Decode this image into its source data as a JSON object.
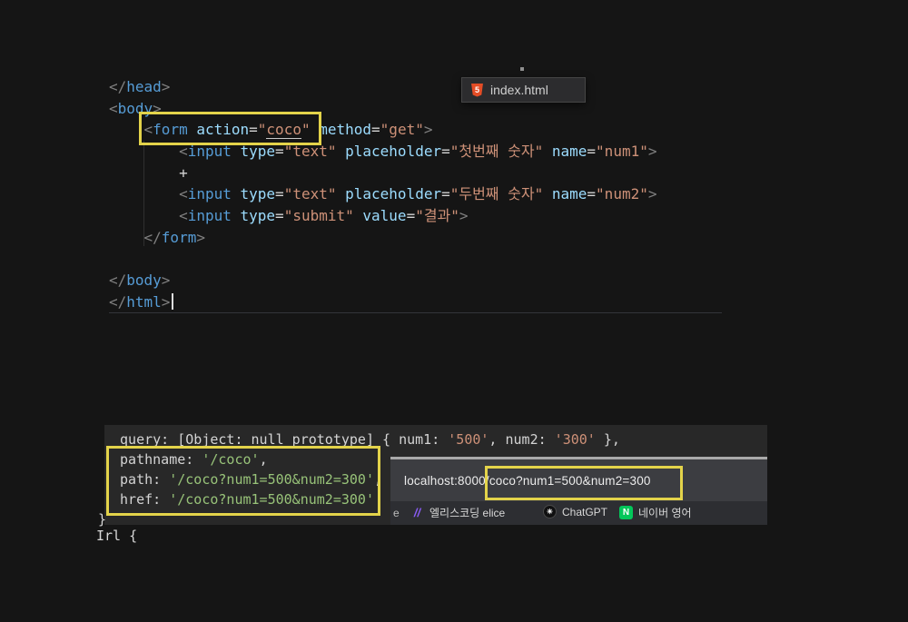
{
  "editor": {
    "lines": [
      {
        "tokens": [
          [
            "</",
            "punct"
          ],
          [
            "head",
            "tag"
          ],
          [
            ">",
            "punct"
          ]
        ]
      },
      {
        "tokens": [
          [
            "<",
            "punct"
          ],
          [
            "body",
            "tag"
          ],
          [
            ">",
            "punct"
          ]
        ]
      },
      {
        "tokens": [
          [
            "    ",
            "plain"
          ],
          [
            "<",
            "punct"
          ],
          [
            "form",
            "tag"
          ],
          [
            " ",
            "plain"
          ],
          [
            "action",
            "attr"
          ],
          [
            "=",
            "plain"
          ],
          [
            "\"",
            "str"
          ],
          [
            "coco",
            "str-u"
          ],
          [
            "\"",
            "str"
          ],
          [
            " ",
            "plain"
          ],
          [
            "method",
            "attr"
          ],
          [
            "=",
            "plain"
          ],
          [
            "\"get\"",
            "str"
          ],
          [
            ">",
            "punct"
          ]
        ]
      },
      {
        "tokens": [
          [
            "        ",
            "plain"
          ],
          [
            "<",
            "punct"
          ],
          [
            "input",
            "tag"
          ],
          [
            " ",
            "plain"
          ],
          [
            "type",
            "attr"
          ],
          [
            "=",
            "plain"
          ],
          [
            "\"text\"",
            "str"
          ],
          [
            " ",
            "plain"
          ],
          [
            "placeholder",
            "attr"
          ],
          [
            "=",
            "plain"
          ],
          [
            "\"첫번째 숫자\"",
            "str"
          ],
          [
            " ",
            "plain"
          ],
          [
            "name",
            "attr"
          ],
          [
            "=",
            "plain"
          ],
          [
            "\"num1\"",
            "str"
          ],
          [
            ">",
            "punct"
          ]
        ]
      },
      {
        "tokens": [
          [
            "        +",
            "plain"
          ]
        ]
      },
      {
        "tokens": [
          [
            "        ",
            "plain"
          ],
          [
            "<",
            "punct"
          ],
          [
            "input",
            "tag"
          ],
          [
            " ",
            "plain"
          ],
          [
            "type",
            "attr"
          ],
          [
            "=",
            "plain"
          ],
          [
            "\"text\"",
            "str"
          ],
          [
            " ",
            "plain"
          ],
          [
            "placeholder",
            "attr"
          ],
          [
            "=",
            "plain"
          ],
          [
            "\"두번째 숫자\"",
            "str"
          ],
          [
            " ",
            "plain"
          ],
          [
            "name",
            "attr"
          ],
          [
            "=",
            "plain"
          ],
          [
            "\"num2\"",
            "str"
          ],
          [
            ">",
            "punct"
          ]
        ]
      },
      {
        "tokens": [
          [
            "        ",
            "plain"
          ],
          [
            "<",
            "punct"
          ],
          [
            "input",
            "tag"
          ],
          [
            " ",
            "plain"
          ],
          [
            "type",
            "attr"
          ],
          [
            "=",
            "plain"
          ],
          [
            "\"submit\"",
            "str"
          ],
          [
            " ",
            "plain"
          ],
          [
            "value",
            "attr"
          ],
          [
            "=",
            "plain"
          ],
          [
            "\"결과\"",
            "str"
          ],
          [
            ">",
            "punct"
          ]
        ]
      },
      {
        "tokens": [
          [
            "    ",
            "plain"
          ],
          [
            "</",
            "punct"
          ],
          [
            "form",
            "tag"
          ],
          [
            ">",
            "punct"
          ]
        ]
      },
      {
        "tokens": []
      },
      {
        "tokens": [
          [
            "</",
            "punct"
          ],
          [
            "body",
            "tag"
          ],
          [
            ">",
            "punct"
          ]
        ]
      },
      {
        "tokens": [
          [
            "</",
            "punct"
          ],
          [
            "html",
            "tag"
          ],
          [
            ">",
            "punct"
          ]
        ],
        "cursor": true
      }
    ]
  },
  "tooltip": {
    "label": "index.html",
    "icon_glyph": "5"
  },
  "terminal": {
    "lines": [
      {
        "tokens": [
          [
            " query: [Object: null prototype] { num1: ",
            "plain"
          ],
          [
            "'500'",
            "orange"
          ],
          [
            ", num2: ",
            "plain"
          ],
          [
            "'300'",
            "orange"
          ],
          [
            " },",
            "plain"
          ]
        ]
      },
      {
        "tokens": [
          [
            " pathname: ",
            "plain"
          ],
          [
            "'/coco'",
            "green"
          ],
          [
            ",",
            "plain"
          ]
        ]
      },
      {
        "tokens": [
          [
            " path: ",
            "plain"
          ],
          [
            "'/coco?num1=500&num2=300'",
            "green"
          ],
          [
            ",",
            "plain"
          ]
        ]
      },
      {
        "tokens": [
          [
            " href: ",
            "plain"
          ],
          [
            "'/coco?num1=500&num2=300'",
            "green"
          ]
        ]
      }
    ],
    "after_lines": [
      "}",
      "Irl {"
    ]
  },
  "browser": {
    "address_host": "localhost:8000",
    "address_path": "/coco?num1=500&num2=300",
    "clipped_bookmark": "e",
    "bookmarks": [
      {
        "icon": "elice-icon",
        "glyph": "//",
        "label": "엘리스코딩 elice"
      },
      {
        "icon": "chatgpt-icon",
        "glyph": "✳",
        "label": "ChatGPT"
      },
      {
        "icon": "naver-icon",
        "glyph": "N",
        "label": "네이버 영어"
      }
    ]
  },
  "colors": {
    "highlight_yellow": "#e3d34a",
    "tag_blue": "#569cd6",
    "attr_blue": "#9cdcfe",
    "string_orange": "#ce9178",
    "terminal_green": "#98c379",
    "html5_orange": "#e44d26",
    "naver_green": "#03c75a"
  }
}
